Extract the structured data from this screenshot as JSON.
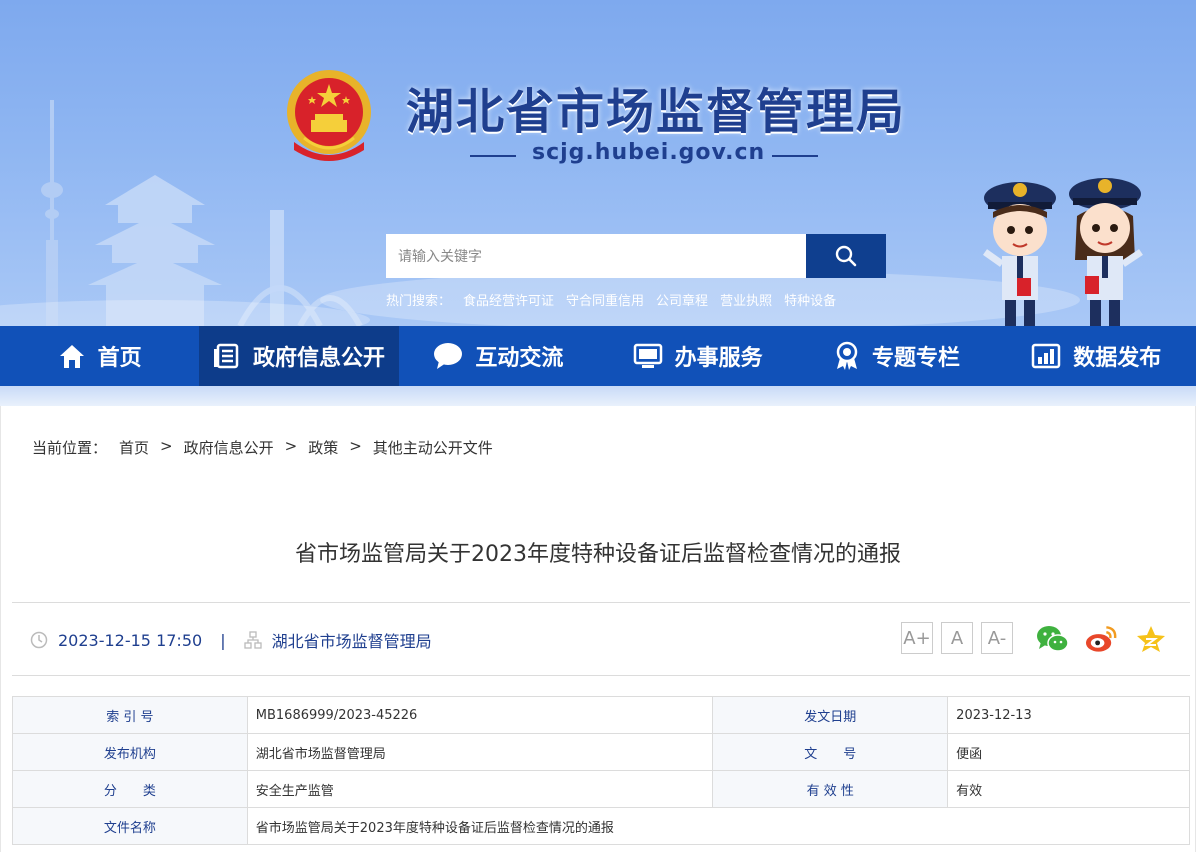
{
  "header": {
    "site_title": "湖北省市场监督管理局",
    "site_domain": "scjg.hubei.gov.cn",
    "search_placeholder": "请输入关键字",
    "hot_label": "热门搜索：",
    "hot_terms": [
      "食品经营许可证",
      "守合同重信用",
      "公司章程",
      "营业执照",
      "特种设备"
    ]
  },
  "nav": {
    "items": [
      {
        "label": "首页",
        "icon": "home-icon"
      },
      {
        "label": "政府信息公开",
        "icon": "document-list-icon",
        "active": true
      },
      {
        "label": "互动交流",
        "icon": "chat-bubble-icon"
      },
      {
        "label": "办事服务",
        "icon": "monitor-icon"
      },
      {
        "label": "专题专栏",
        "icon": "award-ribbon-icon"
      },
      {
        "label": "数据发布",
        "icon": "bar-chart-icon"
      }
    ]
  },
  "breadcrumb": {
    "label": "当前位置：",
    "items": [
      "首页",
      "政府信息公开",
      "政策",
      "其他主动公开文件"
    ],
    "separator": ">"
  },
  "article": {
    "title": "省市场监管局关于2023年度特种设备证后监督检查情况的通报",
    "datetime": "2023-12-15 17:50",
    "meta_separator": "|",
    "publisher": "湖北省市场监督管理局",
    "font_size_buttons": [
      "A+",
      "A",
      "A-"
    ]
  },
  "share": [
    "wechat-icon",
    "weibo-icon",
    "qzone-star-icon"
  ],
  "info_table": {
    "index_no_label": "索 引 号",
    "index_no": "MB1686999/2023-45226",
    "issue_date_label": "发文日期",
    "issue_date": "2023-12-13",
    "org_label": "发布机构",
    "org": "湖北省市场监督管理局",
    "doc_no_label": "文　　号",
    "doc_no": "便函",
    "category_label": "分　　类",
    "category": "安全生产监管",
    "validity_label": "有 效 性",
    "validity": "有效",
    "doc_name_label": "文件名称",
    "doc_name": "省市场监管局关于2023年度特种设备证后监督检查情况的通报"
  },
  "colors": {
    "nav_bg": "#1151b8",
    "nav_active": "#0d3c8a",
    "title_blue": "#1f3f8f",
    "search_btn": "#0f3f8f"
  }
}
